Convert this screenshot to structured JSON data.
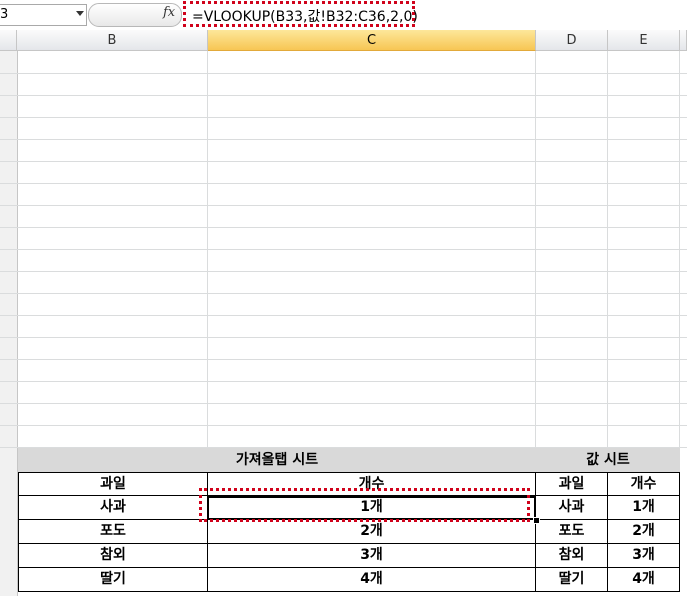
{
  "formula_bar": {
    "name_box": "3",
    "fx_label": "fx",
    "formula": "=VLOOKUP(B33,값!B32:C36,2,0)"
  },
  "columns": [
    "B",
    "C",
    "D",
    "E"
  ],
  "selected_column": "C",
  "table": {
    "left_title": "가져올탭 시트",
    "right_title": "값 시트",
    "left_headers": [
      "과일",
      "개수"
    ],
    "right_headers": [
      "과일",
      "개수"
    ],
    "left_rows": [
      [
        "사과",
        "1개"
      ],
      [
        "포도",
        "2개"
      ],
      [
        "참외",
        "3개"
      ],
      [
        "딸기",
        "4개"
      ]
    ],
    "right_rows": [
      [
        "사과",
        "1개"
      ],
      [
        "포도",
        "2개"
      ],
      [
        "참외",
        "3개"
      ],
      [
        "딸기",
        "4개"
      ]
    ]
  },
  "colors": {
    "highlight_border": "#d0021b",
    "header_band": "#d9d9d9",
    "selected_column_header": "#f7c654"
  }
}
